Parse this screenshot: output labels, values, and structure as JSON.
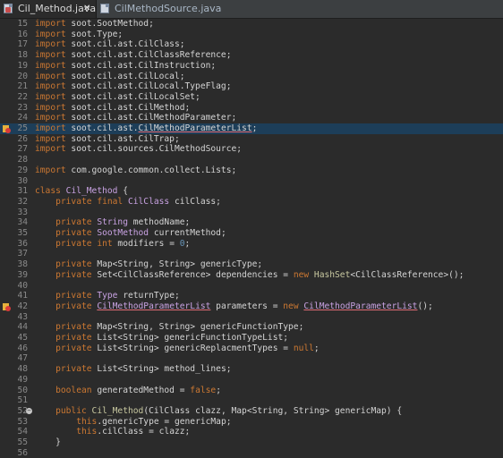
{
  "tabs": [
    {
      "label": "Cil_Method.java",
      "active": true,
      "close": "✕"
    },
    {
      "label": "CilMethodSource.java",
      "active": false
    }
  ],
  "lines": [
    {
      "n": "15",
      "t": "import soot.SootMethod;"
    },
    {
      "n": "16",
      "t": "import soot.Type;"
    },
    {
      "n": "17",
      "t": "import soot.cil.ast.CilClass;"
    },
    {
      "n": "18",
      "t": "import soot.cil.ast.CilClassReference;"
    },
    {
      "n": "19",
      "t": "import soot.cil.ast.CilInstruction;"
    },
    {
      "n": "20",
      "t": "import soot.cil.ast.CilLocal;"
    },
    {
      "n": "21",
      "t": "import soot.cil.ast.CilLocal.TypeFlag;"
    },
    {
      "n": "22",
      "t": "import soot.cil.ast.CilLocalSet;"
    },
    {
      "n": "23",
      "t": "import soot.cil.ast.CilMethod;"
    },
    {
      "n": "24",
      "t": "import soot.cil.ast.CilMethodParameter;"
    },
    {
      "n": "25",
      "t": "import soot.cil.ast.CilMethodParameterList;"
    },
    {
      "n": "26",
      "t": "import soot.cil.ast.CilTrap;"
    },
    {
      "n": "27",
      "t": "import soot.cil.sources.CilMethodSource;"
    },
    {
      "n": "28",
      "t": ""
    },
    {
      "n": "29",
      "t": "import com.google.common.collect.Lists;"
    },
    {
      "n": "30",
      "t": ""
    },
    {
      "n": "31",
      "t": "class Cil_Method {"
    },
    {
      "n": "32",
      "t": "    private final CilClass cilClass;"
    },
    {
      "n": "33",
      "t": ""
    },
    {
      "n": "34",
      "t": "    private String methodName;"
    },
    {
      "n": "35",
      "t": "    private SootMethod currentMethod;"
    },
    {
      "n": "36",
      "t": "    private int modifiers = 0;"
    },
    {
      "n": "37",
      "t": ""
    },
    {
      "n": "38",
      "t": "    private Map<String, String> genericType;"
    },
    {
      "n": "39",
      "t": "    private Set<CilClassReference> dependencies = new HashSet<CilClassReference>();"
    },
    {
      "n": "40",
      "t": ""
    },
    {
      "n": "41",
      "t": "    private Type returnType;"
    },
    {
      "n": "42",
      "t": "    private CilMethodParameterList parameters = new CilMethodParameterList();"
    },
    {
      "n": "43",
      "t": ""
    },
    {
      "n": "44",
      "t": "    private Map<String, String> genericFunctionType;"
    },
    {
      "n": "45",
      "t": "    private List<String> genericFunctionTypeList;"
    },
    {
      "n": "46",
      "t": "    private List<String> genericReplacmentTypes = null;"
    },
    {
      "n": "47",
      "t": ""
    },
    {
      "n": "48",
      "t": "    private List<String> method_lines;"
    },
    {
      "n": "49",
      "t": ""
    },
    {
      "n": "50",
      "t": "    boolean generatedMethod = false;"
    },
    {
      "n": "51",
      "t": ""
    },
    {
      "n": "52",
      "t": "    public Cil_Method(CilClass clazz, Map<String, String> genericMap) {"
    },
    {
      "n": "53",
      "t": "        this.genericType = genericMap;"
    },
    {
      "n": "54",
      "t": "        this.cilClass = clazz;"
    },
    {
      "n": "55",
      "t": "    }"
    },
    {
      "n": "56",
      "t": ""
    }
  ]
}
